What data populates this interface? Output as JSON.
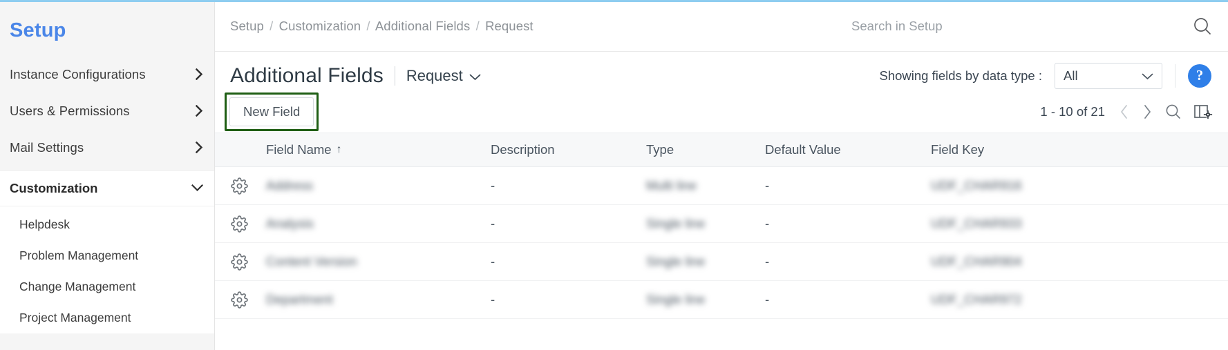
{
  "sidebar": {
    "title": "Setup",
    "top_items": [
      {
        "label": "Instance Configurations",
        "chevron": "chevron-right-icon"
      },
      {
        "label": "Users & Permissions",
        "chevron": "chevron-right-icon"
      },
      {
        "label": "Mail Settings",
        "chevron": "chevron-right-icon"
      }
    ],
    "section": {
      "label": "Customization",
      "chevron": "chevron-down-icon"
    },
    "sub_items": [
      {
        "label": "Helpdesk"
      },
      {
        "label": "Problem Management"
      },
      {
        "label": "Change Management"
      },
      {
        "label": "Project Management"
      }
    ]
  },
  "topbar": {
    "breadcrumb": [
      "Setup",
      "Customization",
      "Additional Fields",
      "Request"
    ],
    "breadcrumb_separator": "/",
    "search": {
      "value": "",
      "placeholder": "Search in Setup",
      "icon": "search-icon"
    }
  },
  "header": {
    "page_title": "Additional Fields",
    "module": "Request",
    "module_caret": "chevron-down-icon",
    "filter_label": "Showing fields by data type :",
    "filter_value": "All",
    "filter_caret": "chevron-down-icon",
    "help_label": "?"
  },
  "toolbar": {
    "new_field_label": "New Field",
    "pagination": "1 - 10 of 21",
    "prev_icon": "chevron-left-icon",
    "next_icon": "chevron-right-icon",
    "search_icon": "search-icon",
    "columns_icon": "column-settings-icon"
  },
  "table": {
    "columns": [
      {
        "key": "gear",
        "label": ""
      },
      {
        "key": "name",
        "label": "Field Name",
        "sort": "ascending",
        "sort_glyph": "↑"
      },
      {
        "key": "description",
        "label": "Description"
      },
      {
        "key": "type",
        "label": "Type"
      },
      {
        "key": "default",
        "label": "Default Value"
      },
      {
        "key": "fieldkey",
        "label": "Field Key"
      }
    ],
    "rows": [
      {
        "gear": "gear-icon",
        "name": "Address",
        "description": "-",
        "type": "Multi line",
        "default": "-",
        "fieldkey": "UDF_CHAR916",
        "blurred": true
      },
      {
        "gear": "gear-icon",
        "name": "Analysis",
        "description": "-",
        "type": "Single line",
        "default": "-",
        "fieldkey": "UDF_CHAR933",
        "blurred": true
      },
      {
        "gear": "gear-icon",
        "name": "Content Version",
        "description": "-",
        "type": "Single line",
        "default": "-",
        "fieldkey": "UDF_CHAR904",
        "blurred": true
      },
      {
        "gear": "gear-icon",
        "name": "Department",
        "description": "-",
        "type": "Single line",
        "default": "-",
        "fieldkey": "UDF_CHAR972",
        "blurred": true
      }
    ]
  },
  "colors": {
    "accent": "#4a86e8",
    "top_border": "#8ecdf0",
    "highlight": "#1f5e14",
    "help": "#2f7fe8"
  }
}
